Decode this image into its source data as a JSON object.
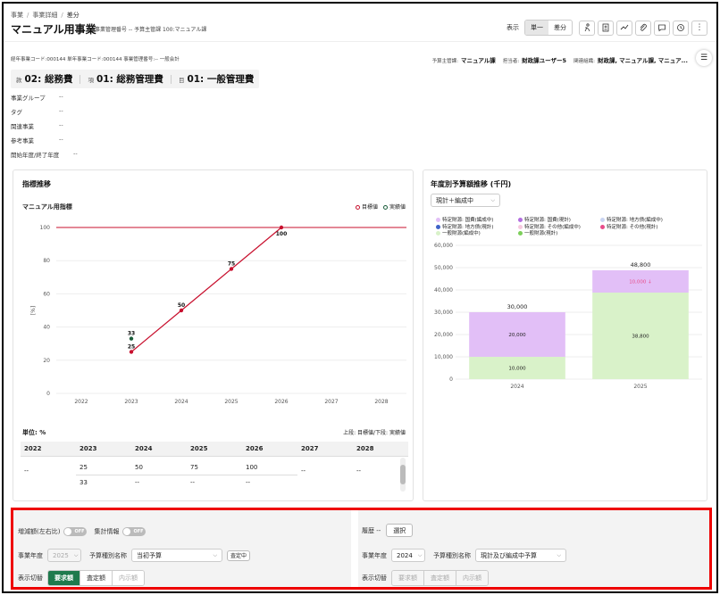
{
  "breadcrumb": [
    "事業",
    "事業詳細",
    "差分"
  ],
  "page": {
    "title": "マニュアル用事業",
    "meta": "事業管理番号 -- 予算主管課 100:マニュアル課"
  },
  "toolbar": {
    "display_label": "表示",
    "seg_single": "単一",
    "seg_diff": "差分",
    "icons": [
      "person-run-icon",
      "calculator-icon",
      "trend-icon",
      "paperclip-icon",
      "comment-icon",
      "history-icon",
      "more-vertical-icon"
    ]
  },
  "codes": "経年事業コード:000144 単年事業コード:000144 事業管理番号:-- 一般会計",
  "assignment": {
    "dept_label": "予算主管課:",
    "dept_value": "マニュアル課",
    "owner_label": "担当者:",
    "owner_value": "財政課ユーザー5",
    "org_label": "関連組織:",
    "org_value": "財政課, マニュアル課, マニュア..."
  },
  "account": [
    {
      "label": "款",
      "value": "02: 総務費"
    },
    {
      "label": "項",
      "value": "01: 総務管理費"
    },
    {
      "label": "目",
      "value": "01: 一般管理費"
    }
  ],
  "info": [
    {
      "label": "事業グループ",
      "value": "--"
    },
    {
      "label": "タグ",
      "value": "--"
    },
    {
      "label": "関連事業",
      "value": "--"
    },
    {
      "label": "参考事業",
      "value": "--"
    },
    {
      "label": "開始年度/終了年度",
      "value": "--"
    }
  ],
  "indicator_card": {
    "title": "指標推移",
    "indicator_name": "マニュアル用指標",
    "legend_target": "目標値",
    "legend_actual": "実績値",
    "ylabel": "[%]",
    "unit": "単位: %",
    "note": "上段: 目標値/下段: 実績値"
  },
  "chart_data": [
    {
      "type": "line",
      "title": "マニュアル用指標",
      "ylabel": "[%]",
      "x": [
        "2022",
        "2023",
        "2024",
        "2025",
        "2026",
        "2027",
        "2028"
      ],
      "yticks": [
        0,
        20,
        40,
        60,
        80,
        100
      ],
      "ylim": [
        0,
        100
      ],
      "reference_line": 100,
      "grid": true,
      "legend": "top-right",
      "series": [
        {
          "name": "目標値",
          "color": "#c8102e",
          "points": [
            {
              "x": "2023",
              "y": 25
            },
            {
              "x": "2024",
              "y": 50
            },
            {
              "x": "2025",
              "y": 75
            },
            {
              "x": "2026",
              "y": 100
            }
          ]
        },
        {
          "name": "実績値",
          "color": "#1a5c3a",
          "points": [
            {
              "x": "2023",
              "y": 33
            }
          ]
        }
      ]
    },
    {
      "type": "bar",
      "title": "年度別予算額推移 (千円)",
      "categories": [
        "2024",
        "2025"
      ],
      "ylim": [
        0,
        60000
      ],
      "yticks": [
        "0",
        "10,000",
        "20,000",
        "30,000",
        "40,000",
        "50,000",
        "60,000"
      ],
      "stacked": true,
      "totals": [
        "30,000",
        "48,800"
      ],
      "series": [
        {
          "name": "一般財源(編成中)",
          "color": "#d9f2c9",
          "values": [
            10000,
            38800
          ],
          "labels": [
            "10,000",
            "38,800"
          ]
        },
        {
          "name": "特定財源: 国費(編成中)",
          "color": "#e2bff7",
          "values": [
            20000,
            10000
          ],
          "labels": [
            "20,000",
            "10,000 ↓"
          ]
        }
      ],
      "legend": [
        {
          "name": "特定財源: 国費(編成中)",
          "color": "#e2bff7"
        },
        {
          "name": "特定財源: 国費(現計)",
          "color": "#b36ee0"
        },
        {
          "name": "特定財源: 地方債(編成中)",
          "color": "#c9d4f2"
        },
        {
          "name": "特定財源: 地方債(現計)",
          "color": "#3f63c8"
        },
        {
          "name": "特定財源: その他(編成中)",
          "color": "#f6c9df"
        },
        {
          "name": "特定財源: その他(現計)",
          "color": "#e84d8a"
        },
        {
          "name": "一般財源(編成中)",
          "color": "#d9f2c9"
        },
        {
          "name": "一般財源(現計)",
          "color": "#7dcf5a"
        }
      ]
    }
  ],
  "budget_card": {
    "title": "年度別予算額推移 (千円)",
    "select_value": "現計＋編成中"
  },
  "table": {
    "headers": [
      "2022",
      "2023",
      "2024",
      "2025",
      "2026",
      "2027",
      "2028"
    ],
    "target": [
      "--",
      "25",
      "50",
      "75",
      "100",
      "--",
      "--"
    ],
    "actual": [
      "",
      "33",
      "--",
      "--",
      "--",
      "",
      ""
    ]
  },
  "bottom_left": {
    "diff_label": "増減額(左右比)",
    "diff_toggle": "OFF",
    "agg_label": "集計情報",
    "agg_toggle": "OFF",
    "year_label": "事業年度",
    "year_value": "2025",
    "type_label": "予算種別名称",
    "type_value": "当初予算",
    "badge": "査定中",
    "switch_label": "表示切替",
    "tabs": [
      "要求額",
      "査定額",
      "内示額"
    ]
  },
  "bottom_right": {
    "history_label": "履歴 --",
    "select_button": "選択",
    "year_label": "事業年度",
    "year_value": "2024",
    "type_label": "予算種別名称",
    "type_value": "現計及び編成中予算",
    "switch_label": "表示切替",
    "tabs": [
      "要求額",
      "査定額",
      "内示額"
    ]
  }
}
